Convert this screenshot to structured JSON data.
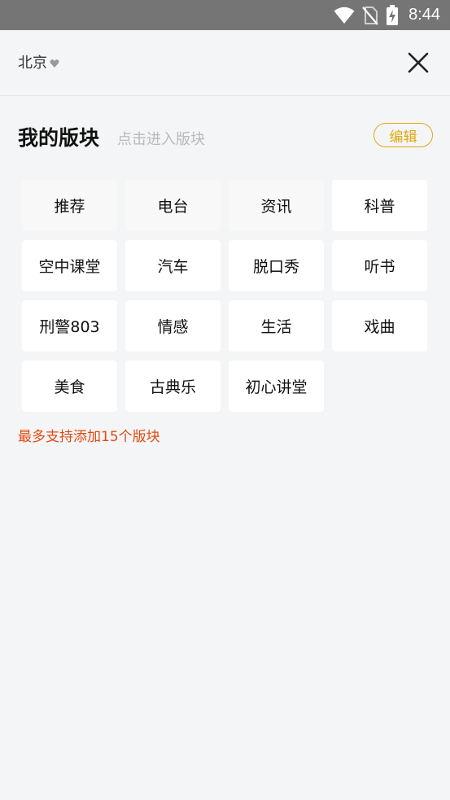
{
  "status_bar": {
    "time": "8:44",
    "icons": [
      "wifi-icon",
      "no-sim-icon",
      "battery-charging-icon"
    ]
  },
  "header": {
    "city": "北京",
    "city_icon": "heart-icon",
    "close_icon": "close-icon"
  },
  "section": {
    "title": "我的版块",
    "hint": "点击进入版块",
    "edit_label": "编辑"
  },
  "tiles": [
    {
      "label": "推荐"
    },
    {
      "label": "电台"
    },
    {
      "label": "资讯"
    },
    {
      "label": "科普"
    },
    {
      "label": "空中课堂"
    },
    {
      "label": "汽车"
    },
    {
      "label": "脱口秀"
    },
    {
      "label": "听书"
    },
    {
      "label": "刑警803"
    },
    {
      "label": "情感"
    },
    {
      "label": "生活"
    },
    {
      "label": "戏曲"
    },
    {
      "label": "美食"
    },
    {
      "label": "古典乐"
    },
    {
      "label": "初心讲堂"
    }
  ],
  "limit_note": "最多支持添加15个版块",
  "colors": {
    "accent": "#e0a80f",
    "warning": "#e24a12",
    "status_bar": "#757575",
    "background": "#f4f5f7"
  }
}
